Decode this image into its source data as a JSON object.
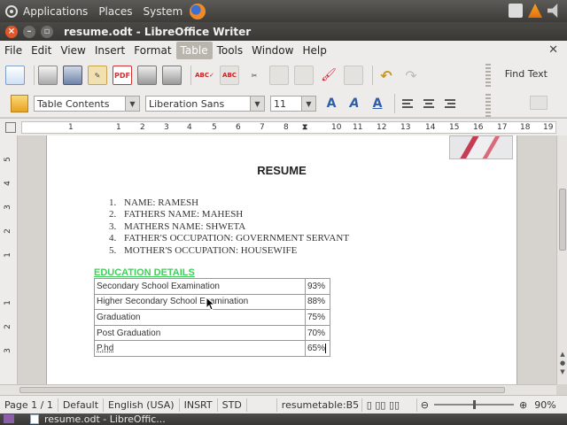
{
  "panel": {
    "menus": [
      "Applications",
      "Places",
      "System"
    ]
  },
  "window": {
    "title": "resume.odt - LibreOffice Writer"
  },
  "menubar": {
    "items": [
      "File",
      "Edit",
      "View",
      "Insert",
      "Format",
      "Table",
      "Tools",
      "Window",
      "Help"
    ],
    "active": "Table"
  },
  "toolbar": {
    "find_text": "Find Text",
    "paragraph_style": "Table Contents",
    "font_name": "Liberation Sans",
    "font_size": "11"
  },
  "ruler": {
    "labels": [
      "1",
      "1",
      "2",
      "3",
      "4",
      "5",
      "6",
      "7",
      "8",
      "10",
      "11",
      "12",
      "13",
      "14",
      "15",
      "16",
      "17",
      "18",
      "19"
    ]
  },
  "vruler": {
    "labels": [
      "5",
      "4",
      "3",
      "2",
      "1",
      "1",
      "2",
      "3"
    ]
  },
  "document": {
    "heading": "RESUME",
    "list": [
      {
        "num": "1.",
        "text": "NAME: RAMESH"
      },
      {
        "num": "2.",
        "text": "FATHERS NAME: MAHESH"
      },
      {
        "num": "3.",
        "text": "MATHERS NAME: SHWETA"
      },
      {
        "num": "4.",
        "text": "FATHER'S OCCUPATION: GOVERNMENT SERVANT"
      },
      {
        "num": "5.",
        "text": "MOTHER'S OCCUPATION: HOUSEWIFE"
      }
    ],
    "education_heading": "EDUCATION DETAILS",
    "education": [
      {
        "exam": "Secondary School Examination",
        "score": "93%"
      },
      {
        "exam": "Higher Secondary School Examination",
        "score": "88%"
      },
      {
        "exam": "Graduation",
        "score": "75%"
      },
      {
        "exam": "Post Graduation",
        "score": "70%"
      },
      {
        "exam": "P.hd",
        "score": "65%"
      }
    ]
  },
  "status": {
    "page": "Page 1 / 1",
    "style": "Default",
    "language": "English (USA)",
    "insert_mode": "INSRT",
    "selection_mode": "STD",
    "cell": "resumetable:B5",
    "zoom": "90%"
  },
  "taskbar": {
    "task": "resume.odt - LibreOffic..."
  }
}
